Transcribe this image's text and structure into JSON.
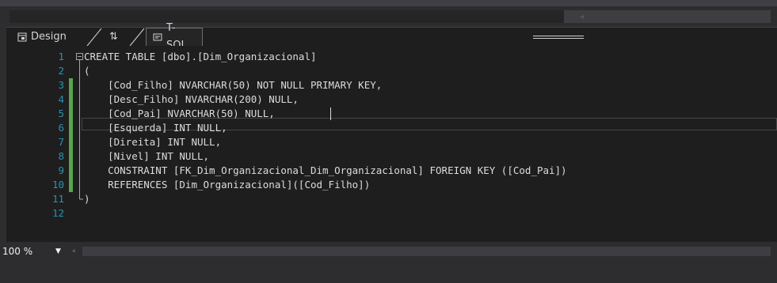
{
  "tabs": {
    "design_label": "Design",
    "swap_label": "⇅",
    "tsql_label": "T-SQL"
  },
  "editor": {
    "lines": [
      {
        "num": "1",
        "text": "CREATE TABLE [dbo].[Dim_Organizacional]"
      },
      {
        "num": "2",
        "text": "("
      },
      {
        "num": "3",
        "text": "    [Cod_Filho] NVARCHAR(50) NOT NULL PRIMARY KEY,"
      },
      {
        "num": "4",
        "text": "    [Desc_Filho] NVARCHAR(200) NULL,"
      },
      {
        "num": "5",
        "text": "    [Cod_Pai] NVARCHAR(50) NULL, "
      },
      {
        "num": "6",
        "text": "    [Esquerda] INT NULL,"
      },
      {
        "num": "7",
        "text": "    [Direita] INT NULL,"
      },
      {
        "num": "8",
        "text": "    [Nivel] INT NULL,"
      },
      {
        "num": "9",
        "text": "    CONSTRAINT [FK_Dim_Organizacional_Dim_Organizacional] FOREIGN KEY ([Cod_Pai])"
      },
      {
        "num": "10",
        "text": "    REFERENCES [Dim_Organizacional]([Cod_Filho])"
      },
      {
        "num": "11",
        "text": ")"
      },
      {
        "num": "12",
        "text": ""
      }
    ]
  },
  "status": {
    "zoom": "100 %"
  },
  "colors": {
    "background": "#1e1e1e",
    "line_number": "#2b91af",
    "change_marker": "#57a64a",
    "text": "#dcdcdc"
  }
}
